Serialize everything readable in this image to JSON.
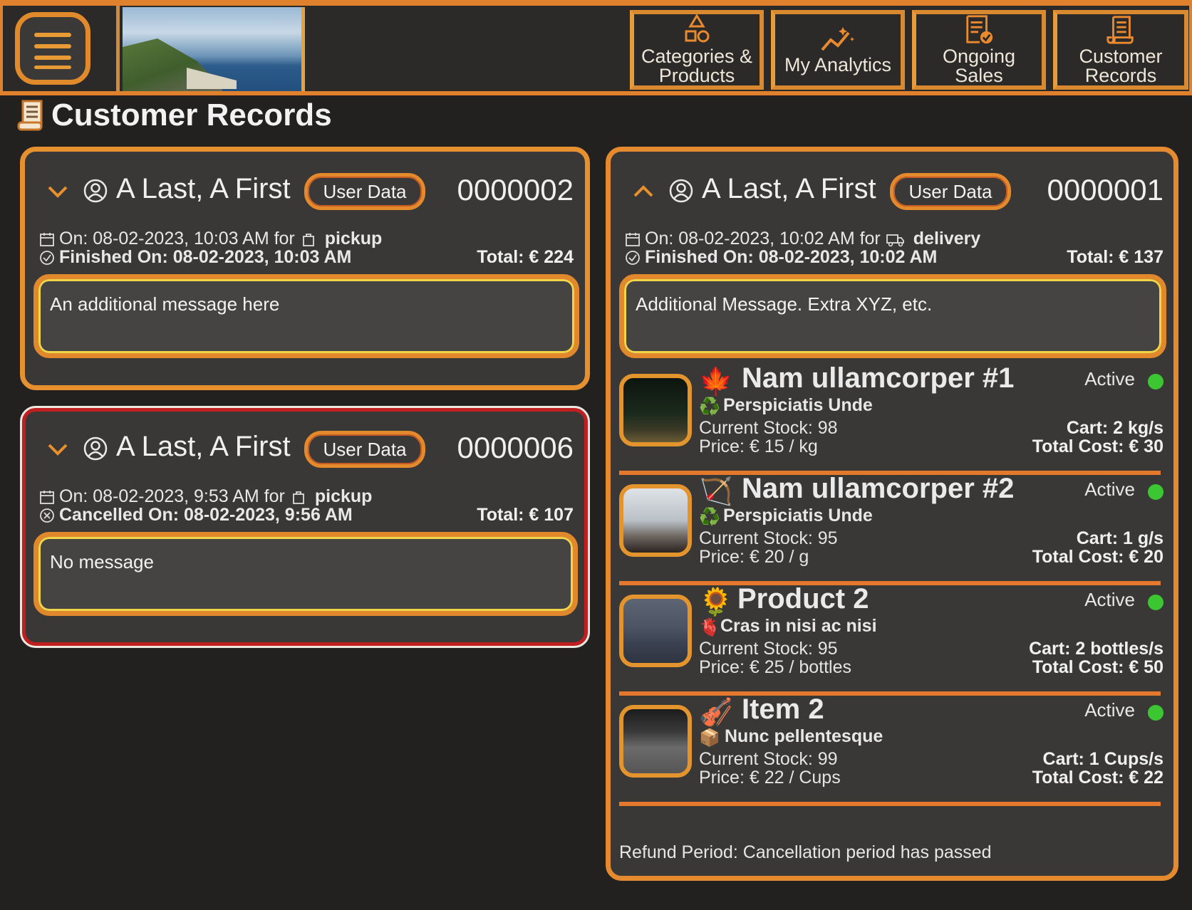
{
  "nav": {
    "items": [
      {
        "label": "Categories &\nProducts",
        "icon": "shapes-icon"
      },
      {
        "label": "My Analytics",
        "icon": "analytics-icon"
      },
      {
        "label": "Ongoing Sales",
        "icon": "receipt-check-icon"
      },
      {
        "label": "Customer\nRecords",
        "icon": "scroll-icon"
      }
    ]
  },
  "page": {
    "title": "Customer Records"
  },
  "orders": [
    {
      "name": "A Last, A First",
      "user_data_label": "User Data",
      "id": "0000002",
      "on_prefix": "On: 08-02-2023, 10:03 AM for",
      "method": "pickup",
      "status_line": "Finished On: 08-02-2023, 10:03 AM",
      "total": "Total: € 224",
      "message": "An additional message here"
    },
    {
      "name": "A Last, A First",
      "user_data_label": "User Data",
      "id": "0000006",
      "on_prefix": "On: 08-02-2023, 9:53 AM for",
      "method": "pickup",
      "status_line": "Cancelled On: 08-02-2023, 9:56 AM",
      "total": "Total: € 107",
      "message": "No message"
    },
    {
      "name": "A Last, A First",
      "user_data_label": "User Data",
      "id": "0000001",
      "on_prefix": "On: 08-02-2023, 10:02 AM for",
      "method": "delivery",
      "status_line": "Finished On: 08-02-2023, 10:02 AM",
      "total": "Total: € 137",
      "message": "Additional Message. Extra XYZ, etc.",
      "products": [
        {
          "name": "Nam ullamcorper #1",
          "emoji": "🍁",
          "category_emoji": "♻️",
          "category": "Perspiciatis Unde",
          "stock": "Current Stock: 98",
          "price": "Price: € 15 / kg",
          "status": "Active",
          "cart": "Cart: 2 kg/s",
          "total_cost": "Total Cost: € 30"
        },
        {
          "name": "Nam ullamcorper #2",
          "emoji": "🏹",
          "category_emoji": "♻️",
          "category": "Perspiciatis Unde",
          "stock": "Current Stock: 95",
          "price": "Price: € 20 / g",
          "status": "Active",
          "cart": "Cart: 1 g/s",
          "total_cost": "Total Cost: € 20"
        },
        {
          "name": "Product 2",
          "emoji": "🌻",
          "category_emoji": "🫀",
          "category": "Cras in nisi ac nisi",
          "stock": "Current Stock: 95",
          "price": "Price: € 25 / bottles",
          "status": "Active",
          "cart": "Cart: 2 bottles/s",
          "total_cost": "Total Cost: € 50"
        },
        {
          "name": "Item 2",
          "emoji": "🎻",
          "category_emoji": "📦",
          "category": "Nunc pellentesque",
          "stock": "Current Stock: 99",
          "price": "Price: € 22 / Cups",
          "status": "Active",
          "cart": "Cart: 1 Cups/s",
          "total_cost": "Total Cost: € 22"
        }
      ],
      "refund": "Refund Period: Cancellation period has passed"
    }
  ],
  "colors": {
    "accent": "#e4892c",
    "accent_yellow": "#f0d44a",
    "cancelled": "#c11f1f",
    "active": "#3cc632",
    "bg": "#222120",
    "card": "#393837"
  }
}
